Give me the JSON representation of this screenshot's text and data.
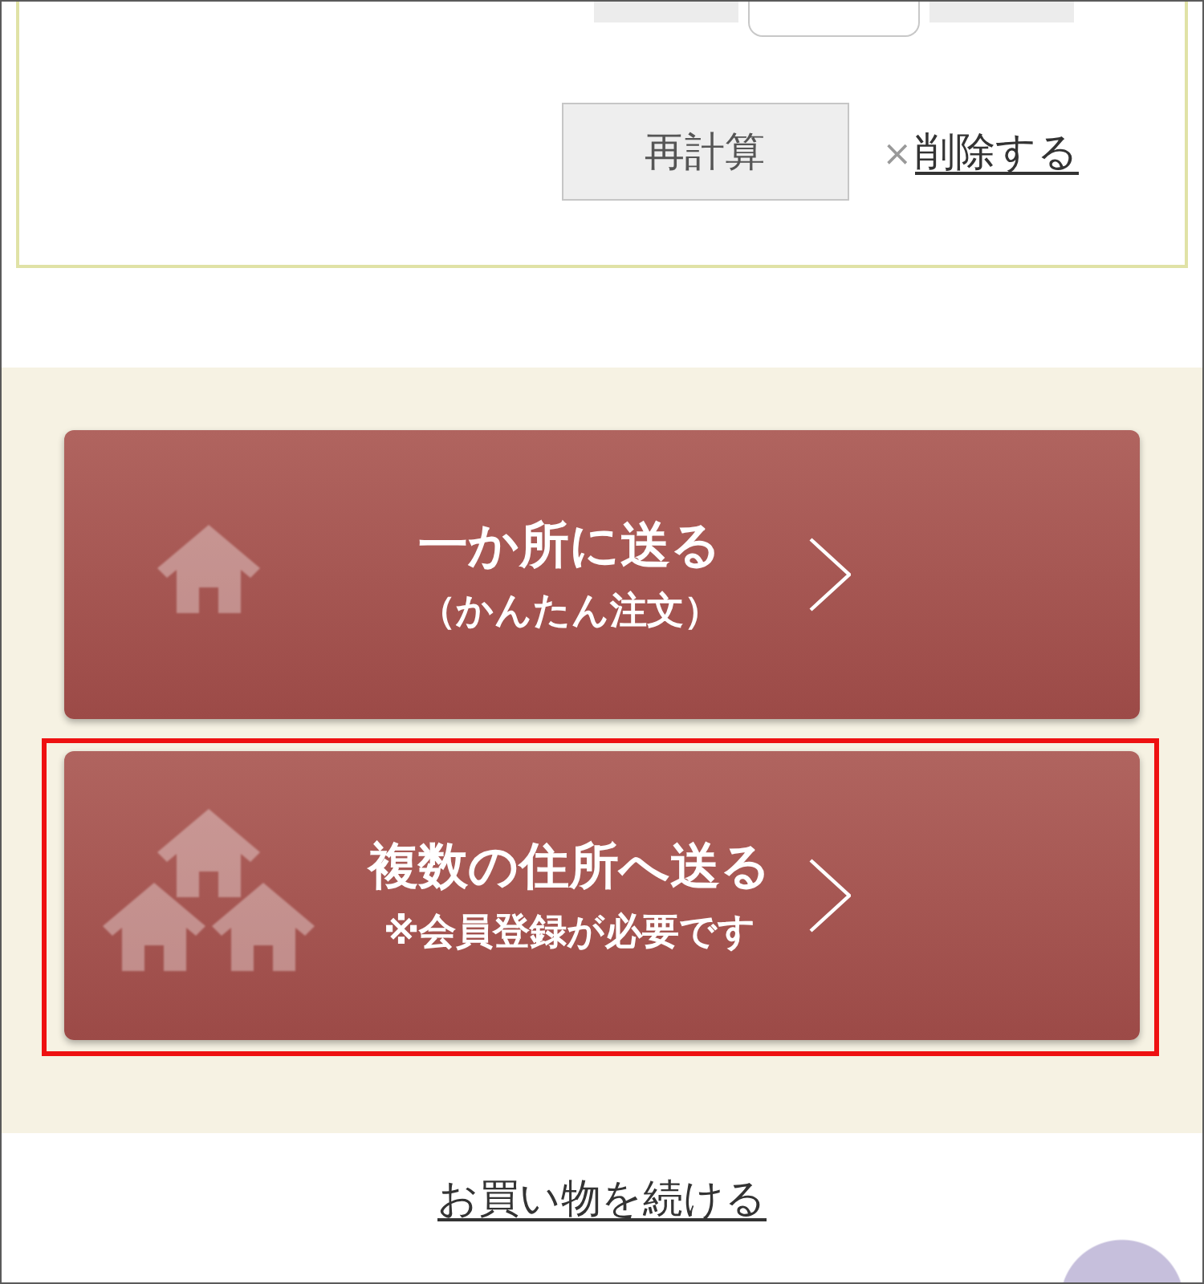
{
  "cart_item": {
    "recalculate_button": "再計算",
    "delete_link": {
      "icon": "×",
      "label": "削除する"
    }
  },
  "order_options": [
    {
      "kind": "single",
      "title": "一か所に送る",
      "subtitle": "（かんたん注文）",
      "highlighted": false
    },
    {
      "kind": "multiple",
      "title": "複数の住所へ送る",
      "subtitle": "※会員登録が必要です",
      "highlighted": true
    }
  ],
  "continue_link": "お買い物を続ける"
}
